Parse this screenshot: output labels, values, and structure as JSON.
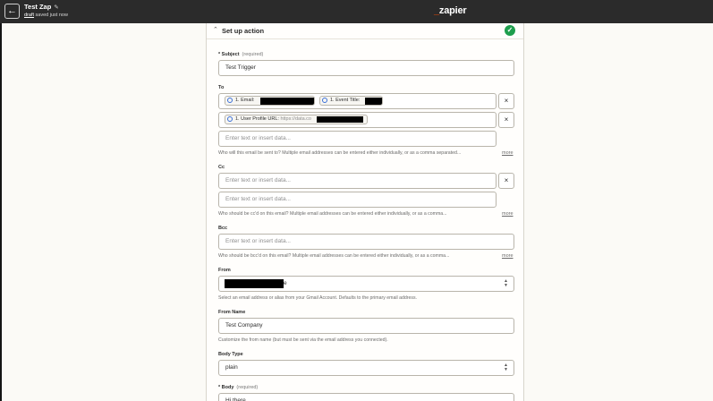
{
  "header": {
    "back_icon": "arrow-left-icon",
    "zap_title": "Test Zap",
    "edit_icon": "pencil-icon",
    "draft_label": "draft",
    "saved_text": "saved just now",
    "logo_underscore": "_",
    "logo_text": "zapier"
  },
  "panel": {
    "title": "Set up action",
    "collapse_icon": "chevron-up-icon",
    "status_icon": "check-circle-icon"
  },
  "subject": {
    "label": "Subject",
    "required": "(required)",
    "value": "Test Trigger"
  },
  "to": {
    "label": "To",
    "pill1": "1. Email:",
    "pill2": "1. Event Title:",
    "pill3_label": "1. User Profile URL:",
    "pill3_value": "https://data.co",
    "placeholder": "Enter text or insert data...",
    "help": "Who will this email be sent to? Multiple email addresses can be entered either individually, or as a comma separated...",
    "more": "more"
  },
  "cc": {
    "label": "Cc",
    "placeholder1": "Enter text or insert data...",
    "placeholder2": "Enter text or insert data...",
    "help": "Who should be cc'd on this email? Multiple email addresses can be entered either individually, or as a comma...",
    "more": "more"
  },
  "bcc": {
    "label": "Bcc",
    "placeholder": "Enter text or insert data...",
    "help": "Who should be bcc'd on this email? Multiple email addresses can be entered either individually, or as a comma...",
    "more": "more"
  },
  "from": {
    "label": "From",
    "value_suffix": "e",
    "help": "Select an email address or alias from your Gmail Account. Defaults to the primary email address."
  },
  "from_name": {
    "label": "From Name",
    "value": "Test Company",
    "help": "Customize the from name (but must be sent via the email address you connected)."
  },
  "body_type": {
    "label": "Body Type",
    "value": "plain"
  },
  "body": {
    "label": "Body",
    "required": "(required)",
    "value": "Hi there,"
  },
  "required_mark": "*",
  "clear_symbol": "×",
  "dropdown_icon": "chevron-updown-icon",
  "colors": {
    "accent": "#ff4f00",
    "success": "#1e9e4d",
    "topbar": "#2b2b2b"
  }
}
